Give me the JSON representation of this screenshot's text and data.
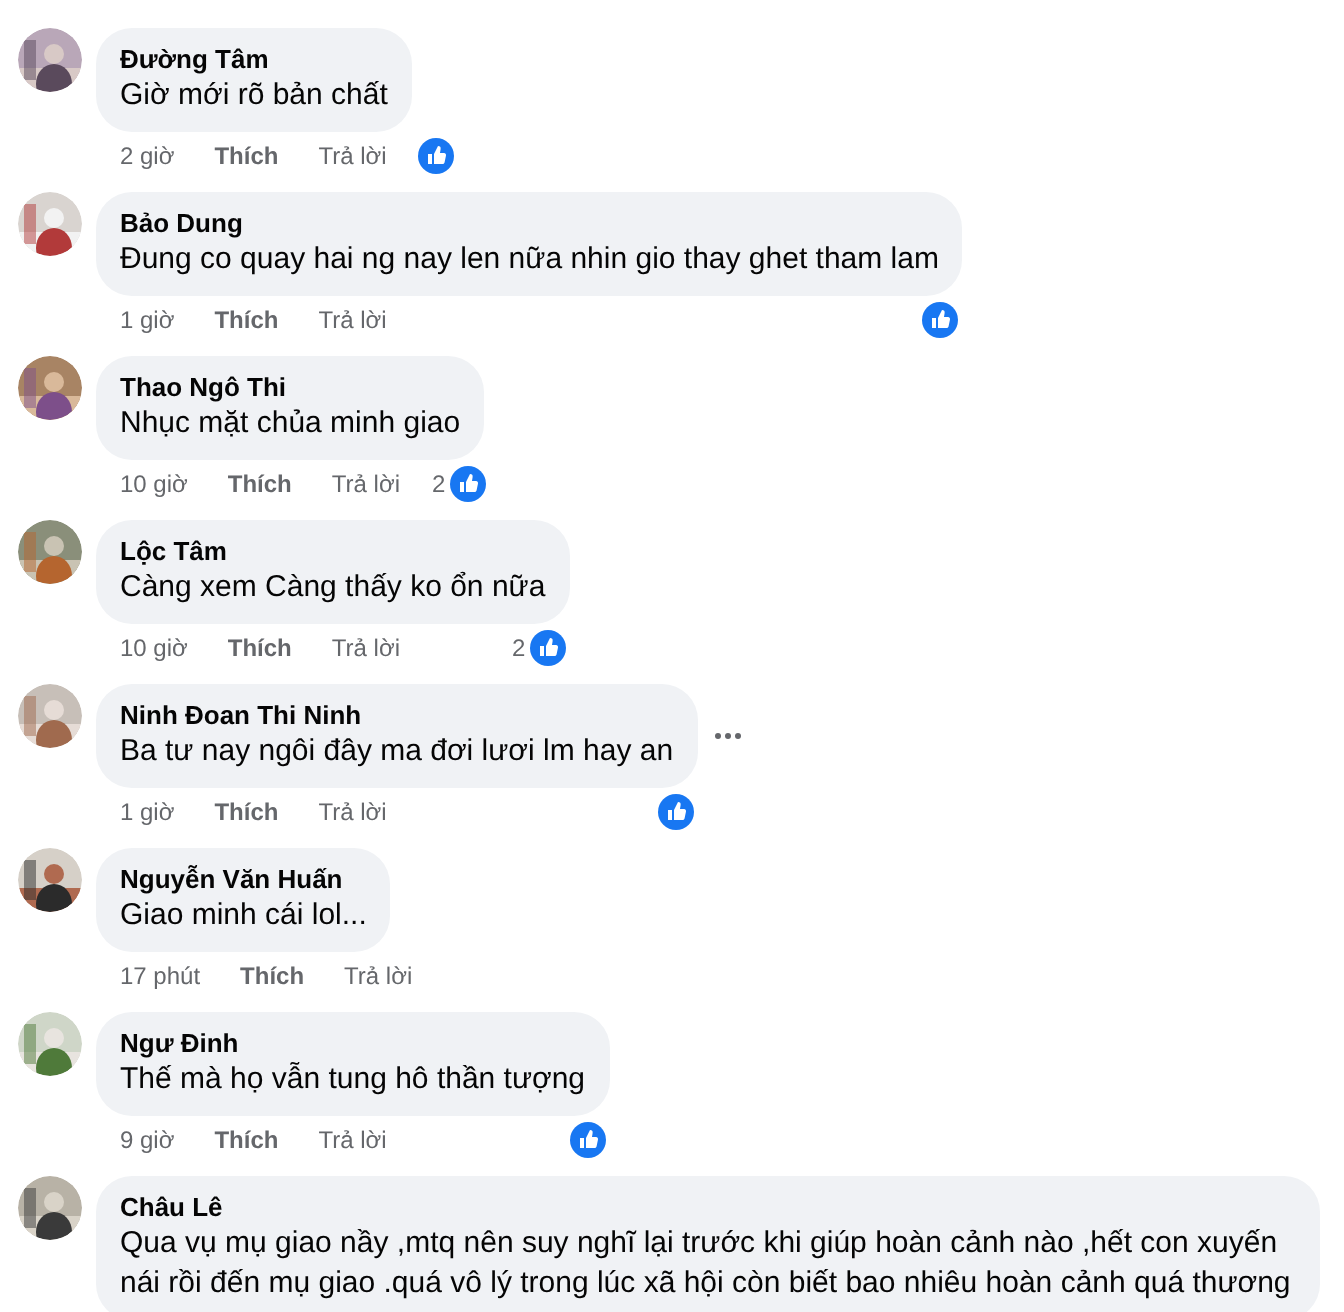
{
  "comments": [
    {
      "name": "Đường Tâm",
      "text": "Giờ mới rõ bản chất",
      "time": "2 giờ",
      "like": "Thích",
      "reply": "Trả lời",
      "reacted": true,
      "options_shown": false
    },
    {
      "name": "Bảo Dung",
      "text": "Đung co quay hai ng nay len nữa nhin gio thay ghet tham lam",
      "time": "1 giờ",
      "like": "Thích",
      "reply": "Trả lời",
      "reacted": true,
      "options_shown": false
    },
    {
      "name": "Thao Ngô Thi",
      "text": "Nhục mặt chủa minh giao",
      "time": "10 giờ",
      "like": "Thích",
      "reply": "Trả lời",
      "reacted": true,
      "reaction_count": "2",
      "options_shown": false
    },
    {
      "name": "Lộc Tâm",
      "text": "Càng xem Càng thấy ko ổn nữa",
      "time": "10 giờ",
      "like": "Thích",
      "reply": "Trả lời",
      "reacted": true,
      "reaction_count": "2",
      "options_shown": false
    },
    {
      "name": "Ninh Đoan Thi Ninh",
      "text": "Ba tư nay ngôi đây ma đơi lươi lm hay an",
      "time": "1 giờ",
      "like": "Thích",
      "reply": "Trả lời",
      "reacted": true,
      "options_shown": true
    },
    {
      "name": "Nguyễn Văn Huấn",
      "text": "Giao minh cái lol...",
      "time": "17 phút",
      "like": "Thích",
      "reply": "Trả lời",
      "reacted": false,
      "options_shown": false
    },
    {
      "name": "Ngư Đinh",
      "text": "Thế mà họ vẫn tung hô thần tượng",
      "time": "9 giờ",
      "like": "Thích",
      "reply": "Trả lời",
      "reacted": true,
      "options_shown": false
    },
    {
      "name": "Châu Lê",
      "text": "Qua vụ mụ giao nầy ,mtq nên suy nghĩ lại trước khi giúp hoàn cảnh nào ,hết con xuyến nái rồi đến mụ giao .quá vô lý trong lúc xã hội còn biết bao nhiêu hoàn cảnh quá thương",
      "options_shown": false
    }
  ]
}
